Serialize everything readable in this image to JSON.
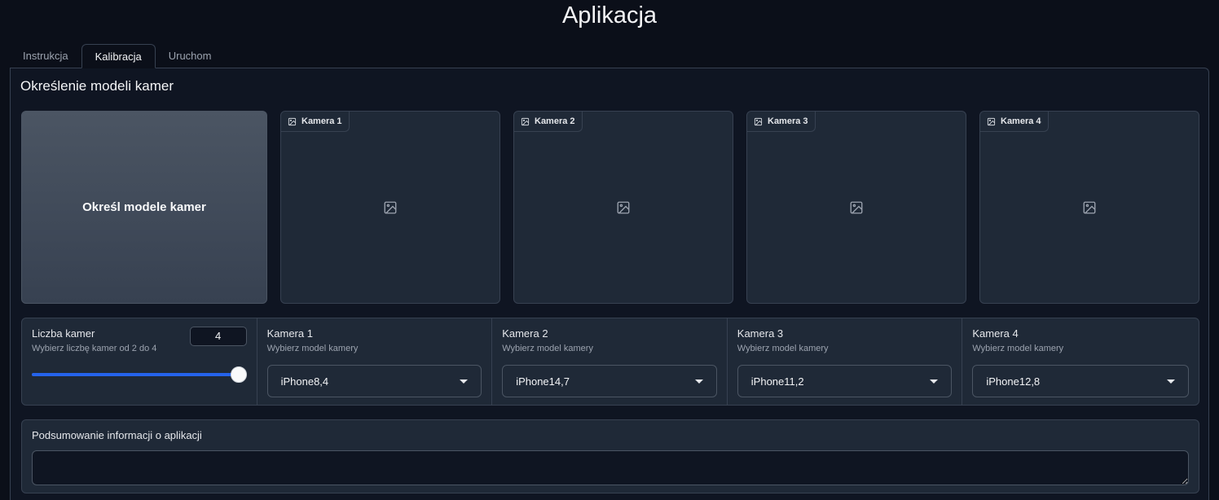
{
  "app": {
    "title": "Aplikacja"
  },
  "tabs": [
    {
      "label": "Instrukcja",
      "active": false
    },
    {
      "label": "Kalibracja",
      "active": true
    },
    {
      "label": "Uruchom",
      "active": false
    }
  ],
  "panel": {
    "title": "Określenie modeli kamer",
    "run_button_label": "Określ modele kamer",
    "images": [
      {
        "label": "Kamera 1",
        "icon": "image-icon"
      },
      {
        "label": "Kamera 2",
        "icon": "image-icon"
      },
      {
        "label": "Kamera 3",
        "icon": "image-icon"
      },
      {
        "label": "Kamera 4",
        "icon": "image-icon"
      }
    ]
  },
  "camera_count": {
    "label": "Liczba kamer",
    "info": "Wybierz liczbę kamer od 2 do 4",
    "value": "4",
    "min": 2,
    "max": 4
  },
  "cameras": [
    {
      "label": "Kamera 1",
      "info": "Wybierz model kamery",
      "value": "iPhone8,4"
    },
    {
      "label": "Kamera 2",
      "info": "Wybierz model kamery",
      "value": "iPhone14,7"
    },
    {
      "label": "Kamera 3",
      "info": "Wybierz model kamery",
      "value": "iPhone11,2"
    },
    {
      "label": "Kamera 4",
      "info": "Wybierz model kamery",
      "value": "iPhone12,8"
    }
  ],
  "summary": {
    "label": "Podsumowanie informacji o aplikacji",
    "value": ""
  },
  "colors": {
    "background": "#0b0f19",
    "block": "#1f2937",
    "accent": "#2563eb"
  }
}
